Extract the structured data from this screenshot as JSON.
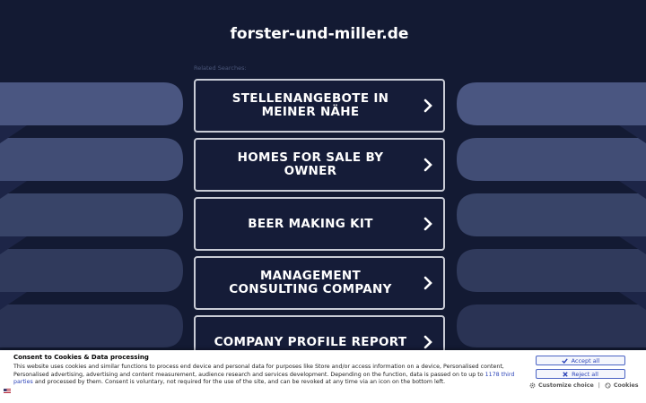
{
  "header": {
    "site_title": "forster-und-miller.de"
  },
  "related": {
    "label": "Related Searches:",
    "links": [
      {
        "text": "STELLENANGEBOTE IN MEINER NÄHE"
      },
      {
        "text": "HOMES FOR SALE BY OWNER"
      },
      {
        "text": "BEER MAKING KIT"
      },
      {
        "text": "MANAGEMENT CONSULTING COMPANY"
      },
      {
        "text": "COMPANY PROFILE REPORT"
      }
    ]
  },
  "consent": {
    "title": "Consent to Cookies & Data processing",
    "text_before": "This website uses cookies and similar functions to process end device and personal data for purposes like Store and/or access information on a device, Personalised content, Personalised advertising, advertising and content measurement, audience research and services development. Depending on the function, data is passed on to up to ",
    "third_parties_link": "1178 third parties",
    "text_after": " and processed by them. Consent is voluntary, not required for the use of the site, and can be revoked at any time via an icon on the bottom left.",
    "accept_label": "Accept all",
    "reject_label": "Reject all",
    "customize_label": "Customize choice",
    "separator": "|",
    "cookies_label": "Cookies"
  },
  "colors": {
    "background": "#131a33",
    "stripe": "#4a5682",
    "link_border": "#c9ccd6",
    "consent_accent": "#2b43b8"
  }
}
